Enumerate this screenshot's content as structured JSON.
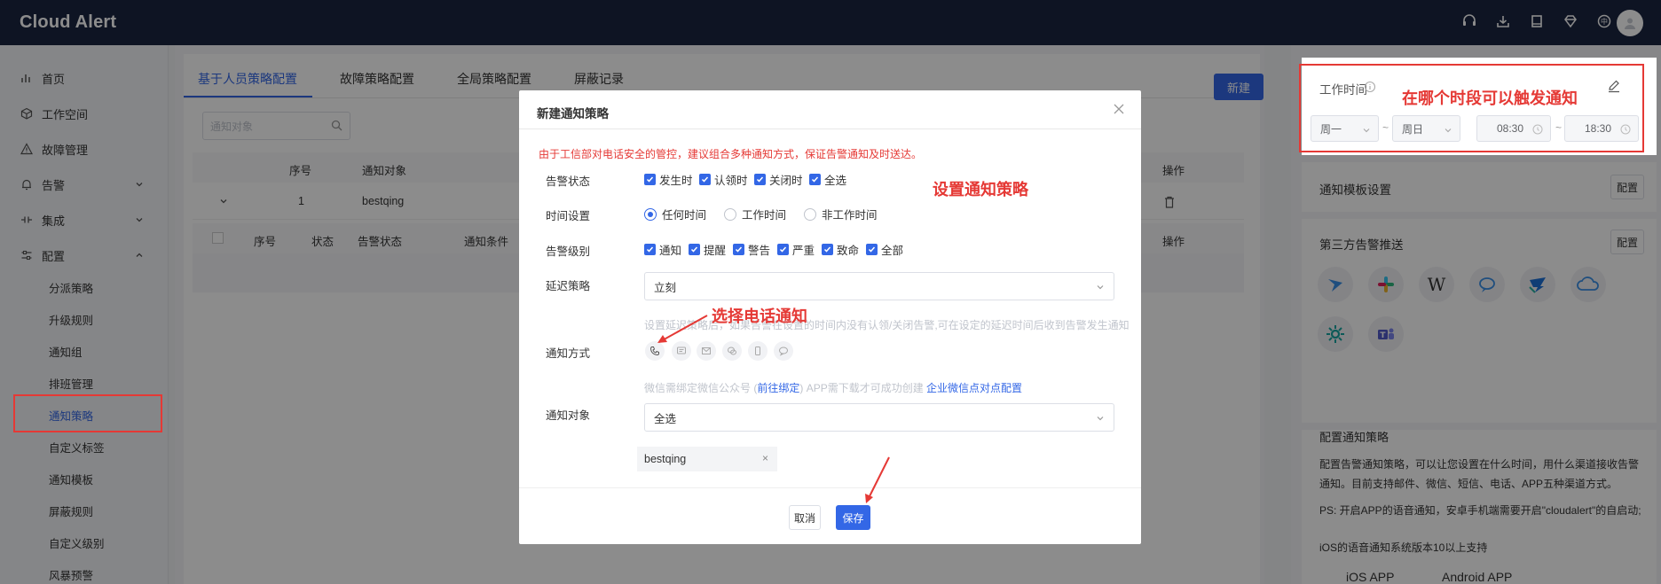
{
  "app": {
    "title": "Cloud Alert"
  },
  "topbar": {
    "icons": [
      "headset-icon",
      "download-icon",
      "book-icon",
      "diamond-icon",
      "language-icon"
    ],
    "avatar": "user-avatar"
  },
  "sidebar": {
    "items": [
      {
        "label": "首页",
        "icon": "bar-chart-icon"
      },
      {
        "label": "工作空间",
        "icon": "cube-icon"
      },
      {
        "label": "故障管理",
        "icon": "warning-icon"
      },
      {
        "label": "告警",
        "icon": "bell-icon"
      },
      {
        "label": "集成",
        "icon": "plug-icon"
      },
      {
        "label": "配置",
        "icon": "sliders-icon"
      }
    ],
    "sub_items": [
      "分派策略",
      "升级规则",
      "通知组",
      "排班管理",
      "通知策略",
      "自定义标签",
      "通知模板",
      "屏蔽规则",
      "自定义级别",
      "风暴预警"
    ],
    "active": "通知策略"
  },
  "tabs": [
    "基于人员策略配置",
    "故障策略配置",
    "全局策略配置",
    "屏蔽记录"
  ],
  "new_button": "新建",
  "search": {
    "placeholder": "通知对象"
  },
  "table": {
    "headers": [
      "序号",
      "通知对象",
      "操作"
    ],
    "row": {
      "index": "1",
      "target": "bestqing"
    },
    "sub_headers": [
      "序号",
      "状态",
      "告警状态",
      "通知条件",
      "操作"
    ]
  },
  "right": {
    "work_time": {
      "title": "工作时间",
      "day_from": "周一",
      "day_to": "周日",
      "time_from": "08:30",
      "time_to": "18:30",
      "sep": "~"
    },
    "template": {
      "title": "通知模板设置",
      "btn": "配置"
    },
    "third_party": {
      "title": "第三方告警推送",
      "btn": "配置"
    },
    "desc": {
      "title": "配置通知策略",
      "p1": "配置告警通知策略，可以让您设置在什么时间，用什么渠道接收告警通知。目前支持邮件、微信、短信、电话、APP五种渠道方式。",
      "p2": "PS: 开启APP的语音通知，安卓手机端需要开启\"cloudalert\"的自启动;",
      "p3": "iOS的语音通知系统版本10以上支持"
    },
    "apps": {
      "ios": "iOS APP",
      "android": "Android APP"
    }
  },
  "modal": {
    "title": "新建通知策略",
    "warning": "由于工信部对电话安全的管控，建议组合多种通知方式，保证告警通知及时送达。",
    "alert_status": {
      "label": "告警状态",
      "options": [
        "发生时",
        "认领时",
        "关闭时",
        "全选"
      ]
    },
    "time_setting": {
      "label": "时间设置",
      "options": [
        "任何时间",
        "工作时间",
        "非工作时间"
      ],
      "selected": "任何时间"
    },
    "alert_level": {
      "label": "告警级别",
      "options": [
        "通知",
        "提醒",
        "警告",
        "严重",
        "致命",
        "全部"
      ]
    },
    "delay": {
      "label": "延迟策略",
      "value": "立刻",
      "hint": "设置延迟策略后，如果告警在设置的时间内没有认领/关闭告警,可在设定的延迟时间后收到告警发生通知"
    },
    "notify_method": {
      "label": "通知方式",
      "channels": [
        "phone-icon",
        "sms-icon",
        "mail-icon",
        "wechat-icon",
        "mobile-app-icon",
        "chat-icon"
      ]
    },
    "wechat_hint": {
      "pre": "微信需绑定微信公众号 (",
      "link1": "前往绑定",
      "mid": ") APP需下载才可成功创建 ",
      "link2": "企业微信点对点配置"
    },
    "notify_target": {
      "label": "通知对象",
      "value": "全选",
      "tag": "bestqing"
    },
    "cancel": "取消",
    "save": "保存"
  },
  "annotations": {
    "trigger_time": "在哪个时段可以触发通知",
    "set_policy": "设置通知策略",
    "choose_phone": "选择电话通知"
  },
  "colors": {
    "primary": "#3367e6",
    "topbar": "#1a2540",
    "annotation": "#e53935"
  }
}
